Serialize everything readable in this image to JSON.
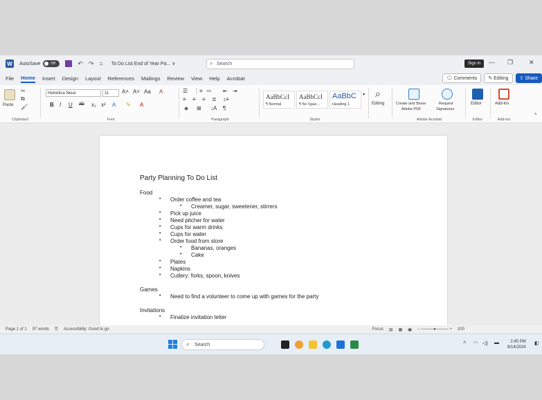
{
  "window": {
    "autosave_label": "AutoSave",
    "autosave_state": "Off",
    "doc_title": "To Do List End of Year Pa... ∨",
    "search_placeholder": "Search",
    "signin_label": "Sign in"
  },
  "tabs": [
    "File",
    "Home",
    "Insert",
    "Design",
    "Layout",
    "References",
    "Mailings",
    "Review",
    "View",
    "Help",
    "Acrobat"
  ],
  "active_tab": "Home",
  "right_buttons": {
    "comments": "Comments",
    "editing": "Editing",
    "share": "Share"
  },
  "ribbon": {
    "clipboard": {
      "paste": "Paste",
      "label": "Clipboard"
    },
    "font": {
      "name": "Helvetica Neue",
      "size": "11",
      "label": "Font"
    },
    "paragraph": {
      "label": "Paragraph"
    },
    "styles": {
      "items": [
        {
          "sample": "AaBbCcI",
          "name": "¶ Normal"
        },
        {
          "sample": "AaBbCcI",
          "name": "¶ No Spac..."
        },
        {
          "sample": "AaBbC",
          "name": "Heading 1"
        }
      ],
      "label": "Styles"
    },
    "editing": {
      "label": "Editing"
    },
    "acrobat": {
      "create_share": "Create and Share",
      "adobe_pdf": "Adobe PDF",
      "request": "Request",
      "signatures": "Signatures",
      "label": "Adobe Acrobat"
    },
    "editor": {
      "label": "Editor",
      "group": "Editor"
    },
    "addins": {
      "label": "Add-ins",
      "group": "Add-ins"
    }
  },
  "document": {
    "title": "Party Planning To Do List",
    "sections": {
      "food": "Food",
      "games": "Games",
      "invitations": "Invitations"
    },
    "food_items": [
      "Order coffee and tea",
      "Creamer, sugar, sweetener, stirrers",
      "Pick up juice",
      "Need pitcher for water",
      "Cups for warm drinks",
      "Cups for water",
      "Order food from store",
      "Bananas, oranges",
      "Cake",
      "Plates",
      "Napkins",
      "Cutlery: forks, spoon, knives"
    ],
    "games_items": [
      "Need to find a volunteer to come up with games for the party"
    ],
    "invitation_items": [
      "Finalize invitation letter"
    ]
  },
  "status": {
    "page": "Page 1 of 1",
    "words": "97 words",
    "accessibility": "Accessibility: Good to go",
    "focus": "Focus",
    "zoom": "100"
  },
  "taskbar": {
    "search": "Search",
    "time": "2:45 PM",
    "date": "8/14/2024"
  }
}
